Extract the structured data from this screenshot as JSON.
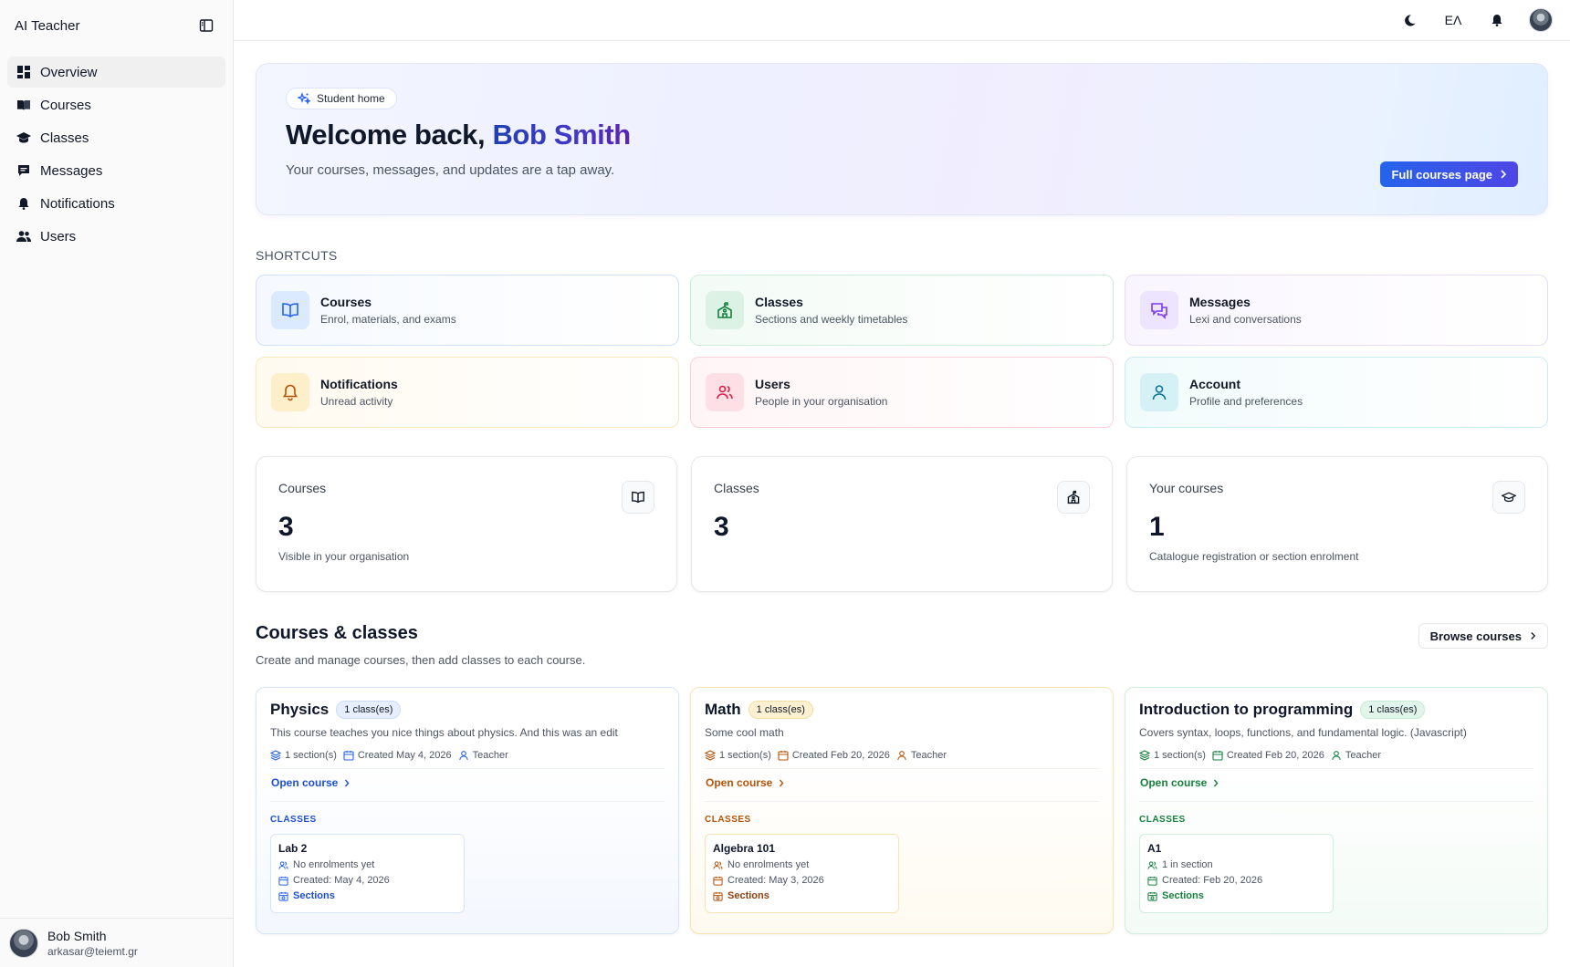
{
  "app": {
    "title": "AI Teacher"
  },
  "sidebar": {
    "items": [
      {
        "label": "Overview",
        "icon": "dashboard-icon",
        "active": true
      },
      {
        "label": "Courses",
        "icon": "book-open-icon"
      },
      {
        "label": "Classes",
        "icon": "graduation-cap-icon"
      },
      {
        "label": "Messages",
        "icon": "chat-icon"
      },
      {
        "label": "Notifications",
        "icon": "bell-icon"
      },
      {
        "label": "Users",
        "icon": "users-icon"
      }
    ],
    "user": {
      "name": "Bob Smith",
      "email": "arkasar@teiemt.gr"
    }
  },
  "topbar": {
    "language": "ΕΛ"
  },
  "hero": {
    "pill": "Student home",
    "title_prefix": "Welcome back,",
    "title_name": "Bob Smith",
    "subtitle": "Your courses, messages, and updates are a tap away.",
    "button": "Full courses page"
  },
  "shortcuts": {
    "label": "SHORTCUTS",
    "items": [
      {
        "title": "Courses",
        "desc": "Enrol, materials, and exams",
        "icon": "book-open-icon",
        "color": "#2563eb"
      },
      {
        "title": "Classes",
        "desc": "Sections and weekly timetables",
        "icon": "school-icon",
        "color": "#15803d"
      },
      {
        "title": "Messages",
        "desc": "Lexi and conversations",
        "icon": "messages-icon",
        "color": "#7c3aed"
      },
      {
        "title": "Notifications",
        "desc": "Unread activity",
        "icon": "bell-icon",
        "color": "#b45309"
      },
      {
        "title": "Users",
        "desc": "People in your organisation",
        "icon": "users-icon",
        "color": "#e11d48"
      },
      {
        "title": "Account",
        "desc": "Profile and preferences",
        "icon": "user-icon",
        "color": "#0e7490"
      }
    ]
  },
  "stats": [
    {
      "label": "Courses",
      "value": "3",
      "desc": "Visible in your organisation",
      "icon": "book-open-icon"
    },
    {
      "label": "Classes",
      "value": "3",
      "desc": "",
      "icon": "school-icon"
    },
    {
      "label": "Your courses",
      "value": "1",
      "desc": "Catalogue registration or section enrolment",
      "icon": "graduation-cap-icon"
    }
  ],
  "courses_section": {
    "title": "Courses & classes",
    "subtitle": "Create and manage courses, then add classes to each course.",
    "browse": "Browse courses",
    "open_label": "Open course",
    "classes_label": "CLASSES",
    "items": [
      {
        "name": "Physics",
        "badge": "1 class(es)",
        "desc": "This course teaches you nice things about physics. And this was an edit",
        "sections": "1 section(s)",
        "created": "Created May 4, 2026",
        "role": "Teacher",
        "class": {
          "name": "Lab 2",
          "enrol": "No enrolments yet",
          "created": "Created: May 4, 2026",
          "link": "Sections"
        }
      },
      {
        "name": "Math",
        "badge": "1 class(es)",
        "desc": "Some cool math",
        "sections": "1 section(s)",
        "created": "Created Feb 20, 2026",
        "role": "Teacher",
        "class": {
          "name": "Algebra 101",
          "enrol": "No enrolments yet",
          "created": "Created: May 3, 2026",
          "link": "Sections"
        }
      },
      {
        "name": "Introduction to programming",
        "badge": "1 class(es)",
        "desc": "Covers syntax, loops, functions, and fundamental logic. (Javascript)",
        "sections": "1 section(s)",
        "created": "Created Feb 20, 2026",
        "role": "Teacher",
        "class": {
          "name": "A1",
          "enrol": "1 in section",
          "created": "Created: Feb 20, 2026",
          "link": "Sections"
        }
      }
    ]
  }
}
